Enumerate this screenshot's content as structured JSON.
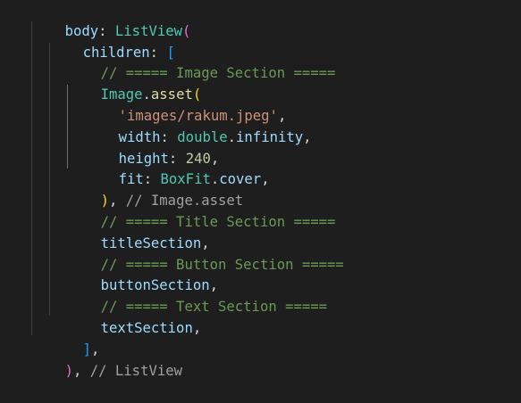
{
  "code": {
    "l1": {
      "key": "body",
      "colon": ":",
      "class": "ListView",
      "paren": "("
    },
    "l2": {
      "key": "children",
      "colon": ":",
      "bracket": "["
    },
    "l3": {
      "comment": "// ===== Image Section ====="
    },
    "l4": {
      "class": "Image",
      "dot": ".",
      "method": "asset",
      "paren": "("
    },
    "l5": {
      "string": "'images/rakum.jpeg'",
      "comma": ","
    },
    "l6": {
      "key": "width",
      "colon": ":",
      "cls": "double",
      "dot": ".",
      "prop": "infinity",
      "comma": ","
    },
    "l7": {
      "key": "height",
      "colon": ":",
      "number": "240",
      "comma": ","
    },
    "l8": {
      "key": "fit",
      "colon": ":",
      "cls": "BoxFit",
      "dot": ".",
      "prop": "cover",
      "comma": ","
    },
    "l9": {
      "paren": ")",
      "comma": ",",
      "comment": "// Image.asset"
    },
    "l10": {
      "comment": "// ===== Title Section ====="
    },
    "l11": {
      "ident": "titleSection",
      "comma": ","
    },
    "l12": {
      "comment": "// ===== Button Section ====="
    },
    "l13": {
      "ident": "buttonSection",
      "comma": ","
    },
    "l14": {
      "comment": "// ===== Text Section ====="
    },
    "l15": {
      "ident": "textSection",
      "comma": ","
    },
    "l16": {
      "bracket": "]",
      "comma": ","
    },
    "l17": {
      "paren": ")",
      "comma": ",",
      "comment": "// ListView"
    }
  }
}
